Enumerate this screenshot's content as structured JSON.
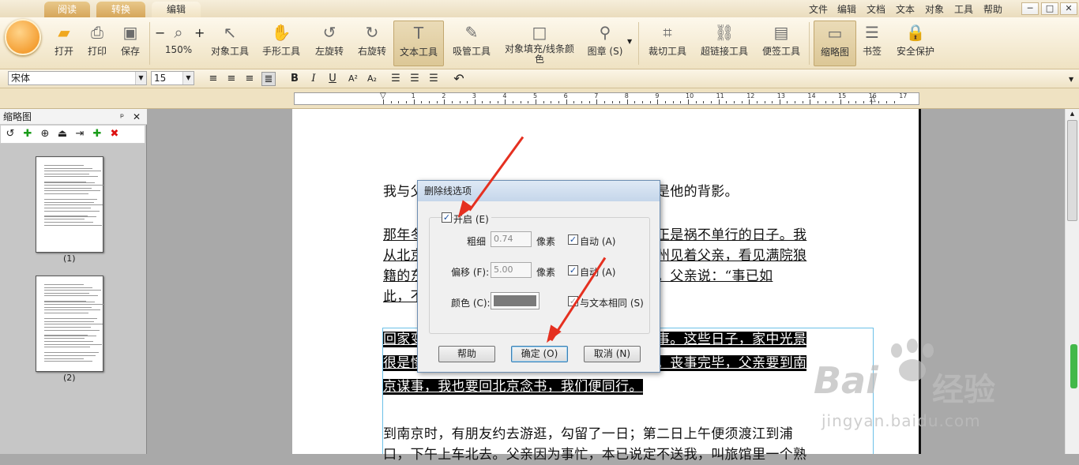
{
  "tabs": [
    {
      "label": "阅读"
    },
    {
      "label": "转换"
    },
    {
      "label": "编辑"
    }
  ],
  "menu": [
    "文件",
    "编辑",
    "文档",
    "文本",
    "对象",
    "工具",
    "帮助"
  ],
  "window_buttons": [
    "─",
    "□",
    "✕"
  ],
  "ribbon": {
    "tools": [
      {
        "label": "打开",
        "icon": "folder-icon"
      },
      {
        "label": "打印",
        "icon": "printer-icon"
      },
      {
        "label": "保存",
        "icon": "save-icon"
      },
      {
        "label": "150%",
        "icon": "zoom-icon"
      },
      {
        "label": "对象工具",
        "icon": "cursor-icon"
      },
      {
        "label": "手形工具",
        "icon": "hand-icon"
      },
      {
        "label": "左旋转",
        "icon": "rotate-left-icon"
      },
      {
        "label": "右旋转",
        "icon": "rotate-right-icon"
      },
      {
        "label": "文本工具",
        "icon": "text-tool-icon"
      },
      {
        "label": "吸管工具",
        "icon": "eyedropper-icon"
      },
      {
        "label": "对象填充/线条颜色",
        "icon": "fill-color-icon"
      },
      {
        "label": "图章 (S)",
        "icon": "stamp-icon"
      },
      {
        "label": "裁切工具",
        "icon": "crop-icon"
      },
      {
        "label": "超链接工具",
        "icon": "link-icon"
      },
      {
        "label": "便签工具",
        "icon": "note-icon"
      },
      {
        "label": "缩略图",
        "icon": "thumbnail-icon"
      },
      {
        "label": "书签",
        "icon": "bookmark-icon"
      },
      {
        "label": "安全保护",
        "icon": "lock-icon"
      }
    ],
    "zoom_minus": "−",
    "zoom_plus": "+"
  },
  "format": {
    "font": "宋体",
    "size": "15",
    "bold": "B",
    "italic": "I",
    "underline": "U",
    "superscript": "A²",
    "subscript": "A₂"
  },
  "sidebar": {
    "title": "缩略图",
    "pin": "ᵖ",
    "close": "✕",
    "pages": [
      {
        "label": "(1)"
      },
      {
        "label": "(2)"
      }
    ]
  },
  "ruler": {
    "ticks": [
      "1",
      "2",
      "3",
      "4",
      "5",
      "6",
      "7",
      "8",
      "9",
      "10",
      "11",
      "12",
      "13",
      "14",
      "15",
      "16",
      "17"
    ]
  },
  "document": {
    "p1": "我与父亲不相见已二年余了，我最不能忘记的是他的背影。",
    "p2a": "那年冬天，祖母死了，父亲的差使也交卸了，正是祸不单行的日子。我",
    "p2b": "从北京到徐州，打算跟着父亲奔丧回家。到徐州见着父亲，看见满院狼",
    "p2c": "籍的东西，又想起祖母，不禁簌簌地流下眼泪。父亲说：“事已如",
    "p2d": "此，不必难过，好在天无绝人之路！”",
    "p3a": "回家变卖典质，父亲还了亏空；又借钱办了丧事。这些日子，家中光景",
    "p3b": "很是惨淡，一半为了丧事，一半为了父亲赋闲。丧事完毕，父亲要到南",
    "p3c": "京谋事，我也要回北京念书，我们便同行。",
    "p4a": "到南京时，有朋友约去游逛，勾留了一日；第二日上午便须渡江到浦",
    "p4b": "口，下午上车北去。父亲因为事忙，本已说定不送我，叫旅馆里一个熟"
  },
  "dialog": {
    "title": "删除线选项",
    "enable": "开启 (E)",
    "weight_label": "粗细",
    "weight_value": "0.74",
    "weight_unit": "像素",
    "weight_auto": "自动 (A)",
    "offset_label": "偏移 (F):",
    "offset_value": "5.00",
    "offset_unit": "像素",
    "offset_auto": "自动 (A)",
    "color_label": "颜色 (C):",
    "same_as_text": "与文本相同 (S)",
    "help": "帮助",
    "ok": "确定 (O)",
    "cancel": "取消 (N)",
    "enable_checked": "✓",
    "weight_auto_checked": "✓",
    "offset_auto_checked": "✓",
    "same_checked": "✓"
  },
  "watermark": {
    "brand": "Bai",
    "brand2": "经验",
    "site": "jingyan.baidu.com"
  }
}
